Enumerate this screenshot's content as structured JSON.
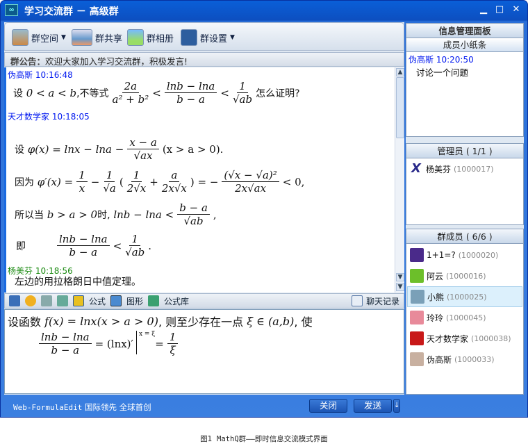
{
  "window": {
    "title": "学习交流群 － 高级群",
    "minimize": "▁",
    "maximize": "□",
    "close": "✕"
  },
  "toolbar": {
    "items": [
      {
        "label": "群空间",
        "dropdown": true,
        "icon": "house-icon"
      },
      {
        "label": "群共享",
        "icon": "folder-share-icon"
      },
      {
        "label": "群相册",
        "icon": "photo-album-icon"
      },
      {
        "label": "群设置",
        "dropdown": true,
        "icon": "gear-icon"
      }
    ]
  },
  "announcement": {
    "label": "群公告：",
    "text": "欢迎大家加入学习交流群，积极发言!"
  },
  "chat": {
    "messages": [
      {
        "sender": "伪高斯",
        "time": "10:16:48"
      },
      {
        "sender": "天才数学家",
        "time": "10:18:05"
      },
      {
        "sender": "杨美芬",
        "time": "10:18:56",
        "text": "左边的用拉格朗日中值定理。"
      }
    ],
    "m1": {
      "a": "设",
      "b": "0 < a < b",
      "c": ",不等式",
      "f1n": "2a",
      "f1d": "a² + b²",
      "lt": "<",
      "f2n": "lnb − lna",
      "f2d": "b − a",
      "f3n": "1",
      "f3d": "√ab",
      "q": "怎么证明?"
    },
    "m2": {
      "l1": {
        "a": "设",
        "b": "φ(x) = lnx − lna −",
        "fn": "x − a",
        "fd": "√ax",
        "c": "(x > a > 0)."
      },
      "l2": {
        "a": "因为",
        "b": "φ′(x) =",
        "f1n": "1",
        "f1d": "x",
        "m": "−",
        "f2n": "1",
        "f2d": "√a",
        "p": "(",
        "f3n": "1",
        "f3d": "2√x",
        "plus": "+",
        "f4n": "a",
        "f4d": "2x√x",
        "e": ") = −",
        "f5n": "(√x − √a)²",
        "f5d": "2x√ax",
        "z": "< 0,"
      },
      "l3": {
        "a": "所以当",
        "b": "b > a > 0",
        "c": "时,",
        "d": "lnb − lna <",
        "fn": "b − a",
        "fd": "√ab",
        "e": ","
      },
      "l4": {
        "a": "即",
        "fn": "lnb − lna",
        "fd": "b − a",
        "lt": "<",
        "gn": "1",
        "gd": "√ab",
        "e": "."
      }
    }
  },
  "input_toolbar": {
    "formula": "公式",
    "graphics": "图形",
    "formula_lib": "公式库",
    "history": "聊天记录"
  },
  "input": {
    "l1a": "设函数",
    "l1b": "f(x) = lnx(x > a > 0)",
    "l1c": ", 则至少存在一点",
    "l1d": "ξ ∈ (a,b)",
    "l1e": ", 使",
    "fn": "lnb − lna",
    "fd": "b − a",
    "eq": "= (lnx)′",
    "sub": "x = ξ",
    "eq2": "=",
    "gn": "1",
    "gd": "ξ"
  },
  "bottom": {
    "slogan_a": "Web-FormulaEdit",
    "slogan_b": "国际领先 全球首创",
    "close": "关闭",
    "send": "发送",
    "send_arrow": "↓"
  },
  "panel": {
    "title": "信息管理面板",
    "notes_title": "成员小纸条",
    "note": {
      "sender": "伪高斯",
      "time": "10:20:50",
      "text": "讨论一个问题"
    },
    "admins_title": "管理员 ( 1/1 )",
    "admins": [
      {
        "name": "杨美芬",
        "id": "(1000017)"
      }
    ],
    "members_title": "群成员 ( 6/6 )",
    "members": [
      {
        "name": "1+1=?",
        "id": "(1000020)",
        "color": "#4a2a8a"
      },
      {
        "name": "阿云",
        "id": "(1000016)",
        "color": "#6cbf2a"
      },
      {
        "name": "小熊",
        "id": "(1000025)",
        "color": "#7aa0b8",
        "selected": true
      },
      {
        "name": "玲玲",
        "id": "(1000045)",
        "color": "#e88a9a"
      },
      {
        "name": "天才数学家",
        "id": "(1000038)",
        "color": "#c81818"
      },
      {
        "name": "伪高斯",
        "id": "(1000033)",
        "color": "#c8b0a0"
      }
    ]
  },
  "caption": {
    "a": "图1",
    "b": "MathQ群——即时信息交流模式界面"
  }
}
